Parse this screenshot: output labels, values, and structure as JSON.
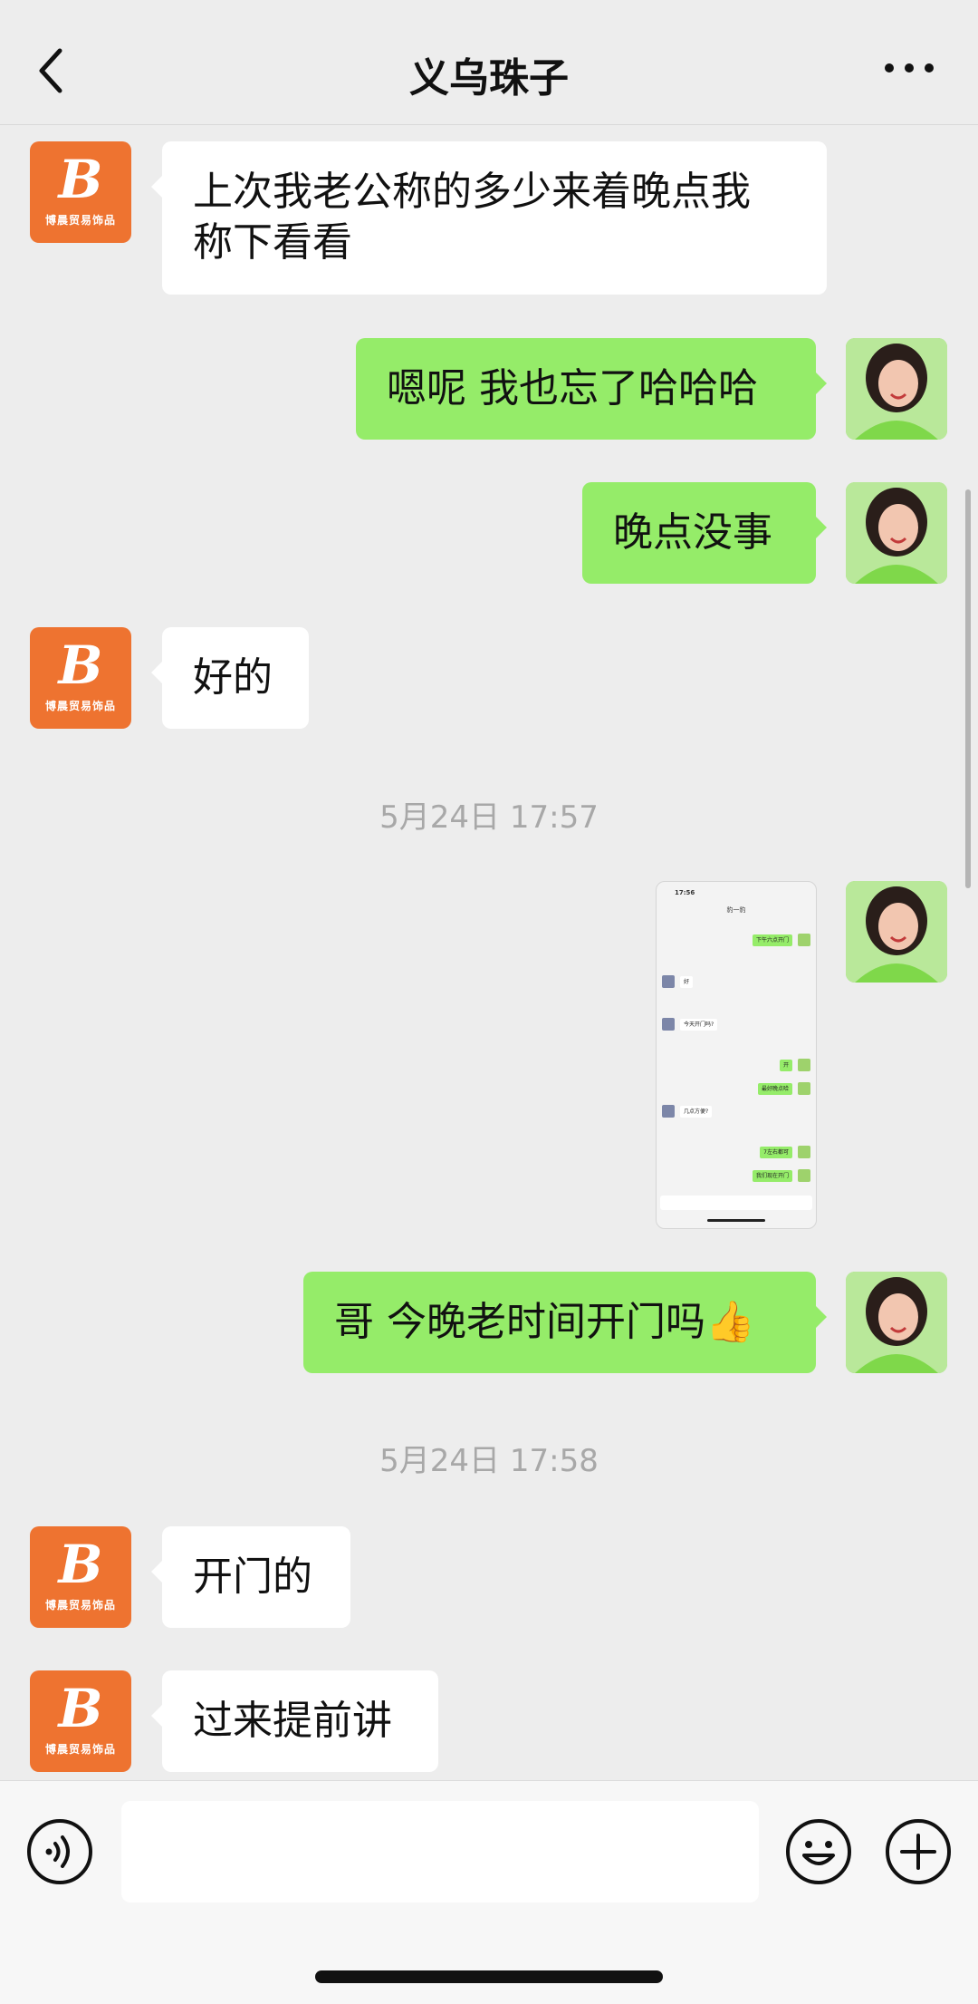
{
  "header": {
    "title": "义乌珠子",
    "back_icon": "chevron-left-icon",
    "more_icon": "ellipsis-icon"
  },
  "contact_avatar": {
    "letter": "B",
    "caption": "博晨贸易饰品",
    "color": "#ee7330"
  },
  "messages": [
    {
      "side": "in",
      "text_line1": "上次我老公称的多少来着晚点我",
      "text_line2": "称下看看"
    },
    {
      "side": "out",
      "text": "嗯呢 我也忘了哈哈哈"
    },
    {
      "side": "out",
      "text": "晚点没事"
    },
    {
      "side": "in",
      "text": "好的"
    },
    {
      "type": "timestamp",
      "text": "5月24日 17:57"
    },
    {
      "side": "out",
      "type": "image",
      "image_name": "chat-screenshot"
    },
    {
      "side": "out",
      "text": "哥 今晚老时间开门吗👍"
    },
    {
      "type": "timestamp",
      "text": "5月24日 17:58"
    },
    {
      "side": "in",
      "text": "开门的"
    },
    {
      "side": "in",
      "text": "过来提前讲"
    }
  ],
  "screenshot_thumb": {
    "time": "17:56",
    "title": "豹一豹",
    "msgs": [
      "下午六点开门",
      "好",
      "今天开门吗?",
      "开",
      "最好晚点哈",
      "几点方便?",
      "7左右都可",
      "我们现在开门"
    ]
  },
  "colors": {
    "bubble_out": "#95ec69",
    "bubble_in": "#ffffff",
    "background": "#ededed"
  },
  "input_bar": {
    "voice_icon": "voice-icon",
    "emoji_icon": "emoji-icon",
    "plus_icon": "plus-circle-icon",
    "placeholder": ""
  }
}
